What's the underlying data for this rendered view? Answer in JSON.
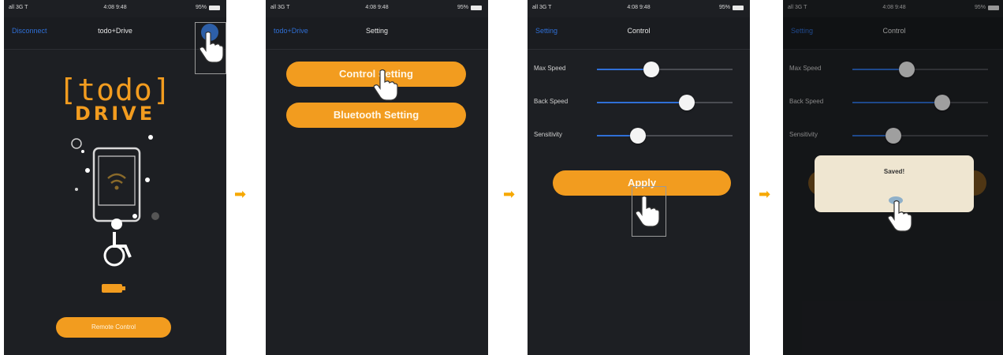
{
  "steps": [
    {
      "status": {
        "carrier": "all 3G T",
        "time": "4:08 9:48",
        "battery": "95%"
      },
      "nav": {
        "back": "Disconnect",
        "title": "todo+Drive"
      },
      "logo": {
        "top": "[todo]",
        "bottom": "DRIVE"
      },
      "remote_button": "Remote Control"
    },
    {
      "status": {
        "carrier": "all 3G T",
        "time": "4:08 9:48",
        "battery": "95%"
      },
      "nav": {
        "back": "todo+Drive",
        "title": "Setting"
      },
      "control_setting": "Control Setting",
      "bluetooth_setting": "Bluetooth Setting"
    },
    {
      "status": {
        "carrier": "all 3G T",
        "time": "4:08 9:48",
        "battery": "95%"
      },
      "nav": {
        "back": "Setting",
        "title": "Control"
      },
      "sliders": [
        {
          "label": "Max Speed",
          "value": 0.4
        },
        {
          "label": "Back Speed",
          "value": 0.66
        },
        {
          "label": "Sensitivity",
          "value": 0.3
        }
      ],
      "apply": "Apply"
    },
    {
      "status": {
        "carrier": "all 3G T",
        "time": "4:08 9:48",
        "battery": "95%"
      },
      "nav": {
        "back": "Setting",
        "title": "Control"
      },
      "sliders": [
        {
          "label": "Max Speed",
          "value": 0.4
        },
        {
          "label": "Back Speed",
          "value": 0.66
        },
        {
          "label": "Sensitivity",
          "value": 0.3
        }
      ],
      "alert": {
        "title": "Saved!"
      }
    }
  ],
  "arrow": "➡",
  "colors": {
    "accent": "#f29c1f",
    "link": "#2f6fd6",
    "background": "#1d1f23"
  }
}
